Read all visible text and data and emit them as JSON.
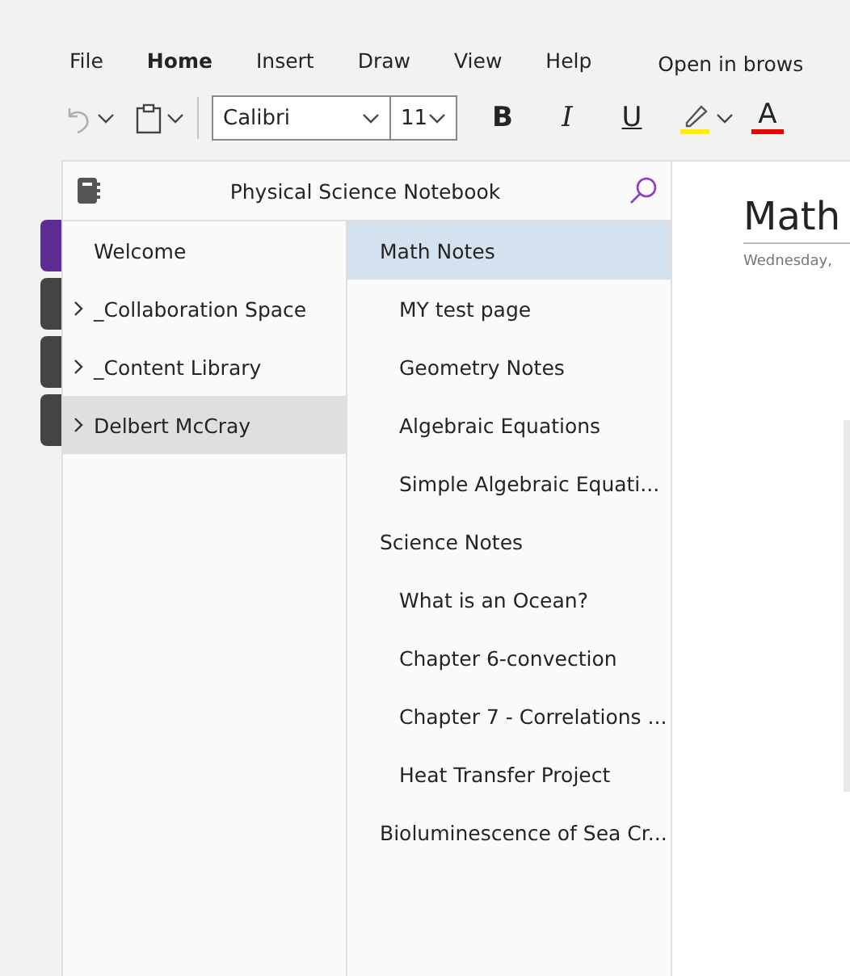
{
  "menu": [
    {
      "label": "File",
      "selected": false
    },
    {
      "label": "Home",
      "selected": true
    },
    {
      "label": "Insert",
      "selected": false
    },
    {
      "label": "Draw",
      "selected": false
    },
    {
      "label": "View",
      "selected": false
    },
    {
      "label": "Help",
      "selected": false
    }
  ],
  "open_in_browser": "Open in brows",
  "toolbar": {
    "undo_disabled": true,
    "font": "Calibri",
    "size": "11",
    "bold": "B",
    "italic": "I",
    "underline": "U",
    "font_color_letter": "A"
  },
  "notebook": {
    "title": "Physical Science Notebook"
  },
  "sections": [
    {
      "label": "Welcome",
      "expandable": false,
      "selected": false,
      "color": "#5c2d91"
    },
    {
      "label": "_Collaboration Space",
      "expandable": true,
      "selected": false,
      "color": "#444444"
    },
    {
      "label": "_Content Library",
      "expandable": true,
      "selected": false,
      "color": "#444444"
    },
    {
      "label": "Delbert McCray",
      "expandable": true,
      "selected": true,
      "color": "#444444"
    }
  ],
  "pages": [
    {
      "label": "Math Notes",
      "selected": true,
      "children": [
        {
          "label": "MY test page",
          "selected": false
        },
        {
          "label": "Geometry Notes",
          "selected": false
        },
        {
          "label": "Algebraic Equations",
          "selected": false
        },
        {
          "label": "Simple Algebraic Equati...",
          "selected": false
        }
      ]
    },
    {
      "label": "Science Notes",
      "selected": false,
      "children": [
        {
          "label": "What is an Ocean?",
          "selected": false
        },
        {
          "label": "Chapter 6-convection",
          "selected": false
        },
        {
          "label": "Chapter 7 - Correlations ...",
          "selected": false
        },
        {
          "label": "Heat Transfer Project",
          "selected": false
        }
      ]
    },
    {
      "label": "Bioluminescence of Sea Cr...",
      "selected": false
    }
  ],
  "page": {
    "title": "Math",
    "date": "Wednesday,"
  }
}
